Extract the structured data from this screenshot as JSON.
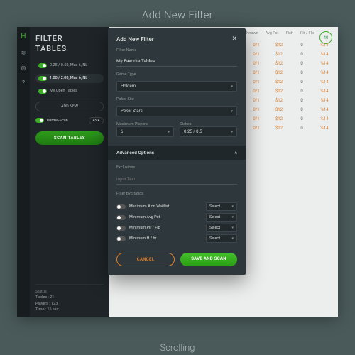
{
  "page_title": "Add New Filter",
  "footer_label": "Scrolling",
  "strip": {
    "logo_glyph": "H"
  },
  "sidebar": {
    "heading_l1": "FILTER",
    "heading_l2": "TABLES",
    "filters": [
      {
        "label": "0.25 / 0.50, Max 6, NL",
        "on": true,
        "active": false
      },
      {
        "label": "1.00 / 2.00, Max 6, NL",
        "on": true,
        "active": true
      },
      {
        "label": "My Open Tables",
        "on": true,
        "active": false
      }
    ],
    "add_new": "ADD NEW",
    "perma_scan": "Perma-Scan",
    "range_pill": "45 ▾",
    "scan_button": "SCAN TABLES",
    "status": {
      "heading": "Status",
      "tables": "Tables : 21",
      "players": "Players : 123",
      "time": "Time : 16 sec"
    }
  },
  "table": {
    "timer": "40",
    "headers": [
      "Known",
      "Avg Pot",
      "Fish",
      "Plr / Flp"
    ],
    "rows": [
      [
        "0/1",
        "$12",
        "0",
        "%14"
      ],
      [
        "0/1",
        "$12",
        "0",
        "%14"
      ],
      [
        "0/1",
        "$12",
        "0",
        "%14"
      ],
      [
        "0/1",
        "$12",
        "0",
        "%14"
      ],
      [
        "0/1",
        "$12",
        "0",
        "%14"
      ],
      [
        "0/1",
        "$12",
        "0",
        "%14"
      ],
      [
        "0/1",
        "$12",
        "0",
        "%14"
      ],
      [
        "0/1",
        "$12",
        "0",
        "%14"
      ],
      [
        "0/1",
        "$12",
        "0",
        "%14"
      ],
      [
        "0/1",
        "$12",
        "0",
        "%14"
      ]
    ]
  },
  "modal": {
    "title": "Add New Filter",
    "filter_name_label": "Filter Name",
    "filter_name_value": "My Favorite Tables",
    "game_type_label": "Game Type",
    "game_type_value": "Holdem",
    "poker_site_label": "Poker Site",
    "poker_site_value": "Poker Stars",
    "max_players_label": "Maximum Players",
    "max_players_value": "6",
    "stakes_label": "Stakes",
    "stakes_value": "0.25 / 0.5",
    "advanced_heading": "Advanced Options",
    "exclusions_label": "Exclusions",
    "exclusions_placeholder": "Input Text",
    "filter_by_statics_label": "Filter By Statics",
    "stat_rows": [
      {
        "label": "Maximum # on Waitlist",
        "select": "Select",
        "on": false
      },
      {
        "label": "Minimum Avg Pot",
        "select": "Select",
        "on": false
      },
      {
        "label": "Minimum Plr / Flp",
        "select": "Select",
        "on": false
      },
      {
        "label": "Minimum H / hr",
        "select": "Select",
        "on": false
      }
    ],
    "cancel": "CANCEL",
    "save": "SAVE AND SCAN"
  }
}
